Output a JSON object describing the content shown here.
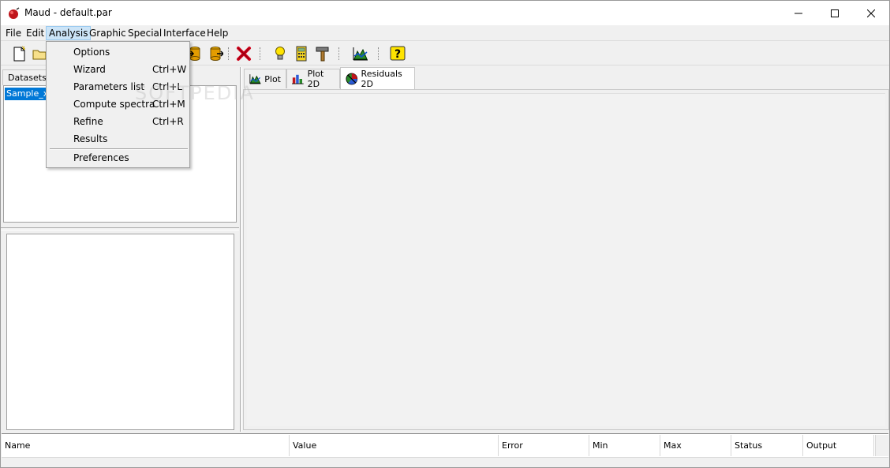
{
  "window": {
    "title": "Maud - default.par"
  },
  "menubar": {
    "items": [
      "File",
      "Edit",
      "Analysis",
      "Graphic",
      "Special",
      "Interface",
      "Help"
    ]
  },
  "toolbar": {
    "icons": [
      "new-file-icon",
      "open-folder-icon",
      "export-icon",
      "import-icon",
      "delete-icon",
      "lightbulb-icon",
      "calculator-icon",
      "hammer-icon",
      "chart-icon",
      "help-icon"
    ]
  },
  "left_panel": {
    "tab_label": "Datasets",
    "datasets": [
      "Sample_x"
    ]
  },
  "tabs": [
    {
      "label": "Plot",
      "icon": "plot-icon"
    },
    {
      "label": "Plot 2D",
      "icon": "plot2d-icon"
    },
    {
      "label": "Residuals 2D",
      "icon": "residuals-icon"
    }
  ],
  "analysis_menu": {
    "items": [
      {
        "label": "Options",
        "shortcut": ""
      },
      {
        "label": "Wizard",
        "shortcut": "Ctrl+W"
      },
      {
        "label": "Parameters list",
        "shortcut": "Ctrl+L"
      },
      {
        "label": "Compute spectra",
        "shortcut": "Ctrl+M"
      },
      {
        "label": "Refine",
        "shortcut": "Ctrl+R"
      },
      {
        "label": "Results",
        "shortcut": ""
      },
      {
        "label": "Preferences",
        "shortcut": ""
      }
    ]
  },
  "parameters_table": {
    "columns": [
      "Name",
      "Value",
      "Error",
      "Min",
      "Max",
      "Status",
      "Output"
    ]
  },
  "watermark": "SOFTPEDIA",
  "colors": {
    "selection": "#0078d7",
    "menu_highlight": "#cce4f7"
  }
}
